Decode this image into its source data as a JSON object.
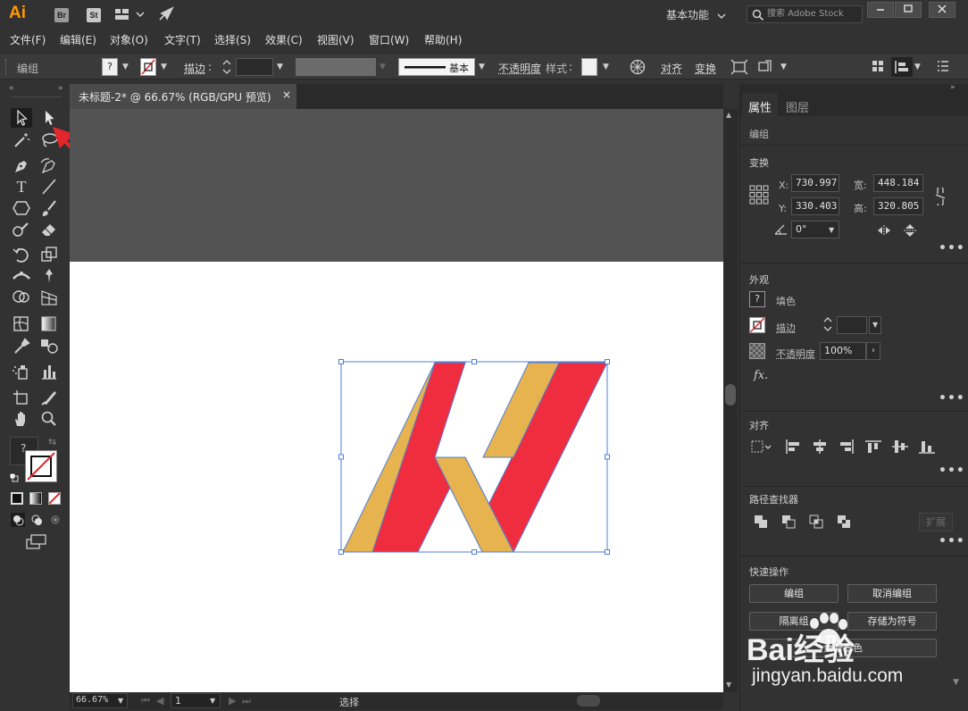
{
  "app": {
    "logo": "Ai",
    "bridge_badge": "Br",
    "stock_badge": "St",
    "workspace": "基本功能",
    "search_placeholder": "搜索 Adobe Stock",
    "accent": "#ff9a00"
  },
  "menu": [
    "文件(F)",
    "编辑(E)",
    "对象(O)",
    "文字(T)",
    "选择(S)",
    "效果(C)",
    "视图(V)",
    "窗口(W)",
    "帮助(H)"
  ],
  "control_bar": {
    "selection_label": "编组",
    "fill_value": "?",
    "stroke_label": "描边",
    "stroke_style": "基本",
    "opacity_label": "不透明度",
    "style_label": "样式",
    "align_label": "对齐",
    "transform_label": "变换"
  },
  "document": {
    "tab_title": "未标题-2* @ 66.67% (RGB/GPU 预览)",
    "close_glyph": "×"
  },
  "statusbar": {
    "zoom": "66.67%",
    "artboard_number": "1",
    "tool_name": "选择"
  },
  "artwork": {
    "colors": {
      "red": "#f02d3f",
      "gold": "#e6b34f",
      "selection": "#4f7fd8"
    }
  },
  "panel": {
    "tabs": [
      "属性",
      "图层"
    ],
    "selection_type": "编组",
    "transform": {
      "title": "变换",
      "x_label": "X:",
      "x": "730.997",
      "y_label": "Y:",
      "y": "330.403",
      "w_label": "宽:",
      "w": "448.184",
      "h_label": "高:",
      "h": "320.805",
      "angle": "0°"
    },
    "appearance": {
      "title": "外观",
      "fill_value": "?",
      "fill_label": "填色",
      "stroke_label": "描边",
      "opacity_label": "不透明度",
      "opacity": "100%",
      "fx": "fx."
    },
    "align_title": "对齐",
    "pathfinder": {
      "title": "路径查找器",
      "expand": "扩展"
    },
    "quick_actions": {
      "title": "快速操作",
      "buttons": [
        "编组",
        "取消编组",
        "隔离组",
        "存储为符号"
      ],
      "bottom_button": "重新着色"
    }
  },
  "watermark": {
    "brand": "Bai经验",
    "url": "jingyan.baidu.com"
  }
}
